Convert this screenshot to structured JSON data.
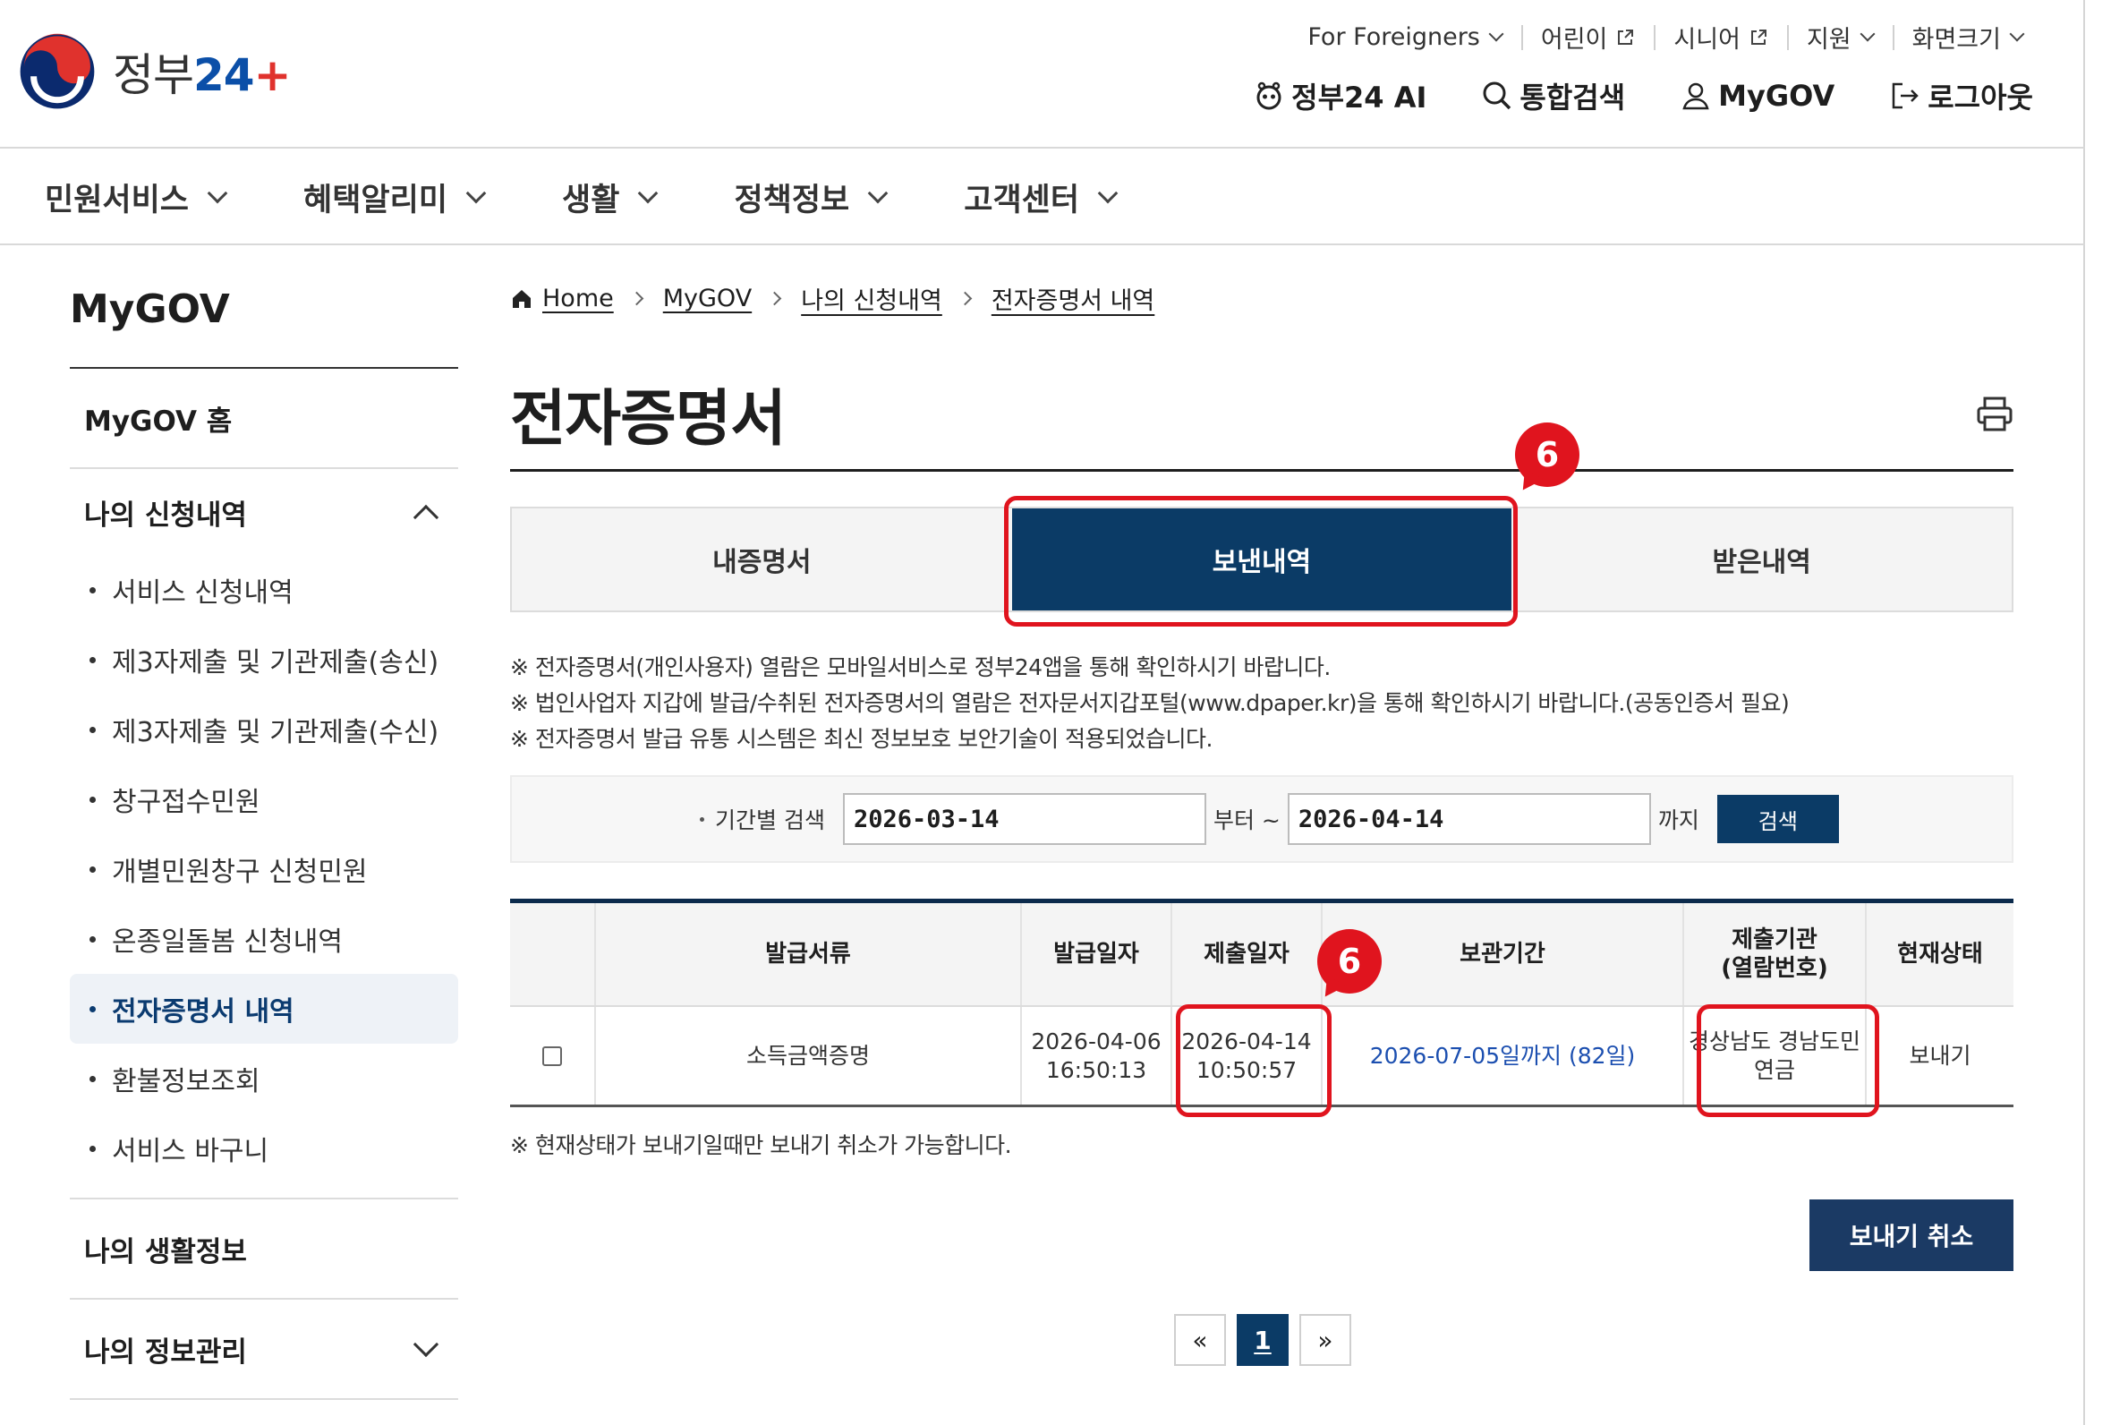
{
  "header": {
    "logo_text": "정부",
    "logo_num": "24",
    "logo_plus": "+",
    "utility": [
      {
        "label": "For Foreigners",
        "type": "dropdown"
      },
      {
        "label": "어린이",
        "type": "external"
      },
      {
        "label": "시니어",
        "type": "external"
      },
      {
        "label": "지원",
        "type": "dropdown"
      },
      {
        "label": "화면크기",
        "type": "dropdown"
      }
    ],
    "quick": [
      {
        "label": "정부24 AI",
        "icon": "robot-icon"
      },
      {
        "label": "통합검색",
        "icon": "search-icon"
      },
      {
        "label": "MyGOV",
        "icon": "user-icon"
      },
      {
        "label": "로그아웃",
        "icon": "logout-icon"
      }
    ]
  },
  "gnb": [
    "민원서비스",
    "혜택알리미",
    "생활",
    "정책정보",
    "고객센터"
  ],
  "side": {
    "title": "MyGOV",
    "home": "MyGOV 홈",
    "section_apply": "나의 신청내역",
    "sub": [
      "서비스 신청내역",
      "제3자제출 및 기관제출(송신)",
      "제3자제출 및 기관제출(수신)",
      "창구접수민원",
      "개별민원창구 신청민원",
      "온종일돌봄 신청내역",
      "전자증명서 내역",
      "환불정보조회",
      "서비스 바구니"
    ],
    "active_index": 6,
    "section_life": "나의 생활정보",
    "section_info": "나의 정보관리"
  },
  "breadcrumb": [
    "Home",
    "MyGOV",
    "나의 신청내역",
    "전자증명서 내역"
  ],
  "page_title": "전자증명서",
  "tabs": [
    "내증명서",
    "보낸내역",
    "받은내역"
  ],
  "active_tab": 1,
  "badges": [
    "6",
    "6"
  ],
  "notices": [
    "※ 전자증명서(개인사용자) 열람은 모바일서비스로 정부24앱을 통해 확인하시기 바랍니다.",
    "※ 법인사업자 지갑에 발급/수취된 전자증명서의 열람은 전자문서지갑포털(www.dpaper.kr)을 통해 확인하시기 바랍니다.(공동인증서 필요)",
    "※ 전자증명서 발급 유통 시스템은 최신 정보보호 보안기술이 적용되었습니다."
  ],
  "search": {
    "label": "기간별 검색",
    "from": "2026-03-14",
    "from_suffix": "부터 ~",
    "to": "2026-04-14",
    "to_suffix": "까지",
    "button": "검색"
  },
  "table": {
    "headers": [
      "",
      "발급서류",
      "발급일자",
      "제출일자",
      "보관기간",
      "제출기관\n(열람번호)",
      "현재상태"
    ],
    "headers_split": {
      "inst_1": "제출기관",
      "inst_2": "(열람번호)"
    },
    "rows": [
      {
        "doc": "소득금액증명",
        "issue_date": "2026-04-06",
        "issue_time": "16:50:13",
        "submit_date": "2026-04-14",
        "submit_time": "10:50:57",
        "retention": "2026-07-05일까지 (82일)",
        "inst_1": "경상남도 경남도민",
        "inst_2": "연금",
        "status": "보내기"
      }
    ]
  },
  "note2": "※ 현재상태가 보내기일때만 보내기 취소가 가능합니다.",
  "cancel_button": "보내기 취소",
  "pager": {
    "prev": "«",
    "current": "1",
    "next": "»"
  },
  "colors": {
    "navy": "#0b3b66",
    "highlight": "#e0141e",
    "link": "#1c4fb0"
  }
}
